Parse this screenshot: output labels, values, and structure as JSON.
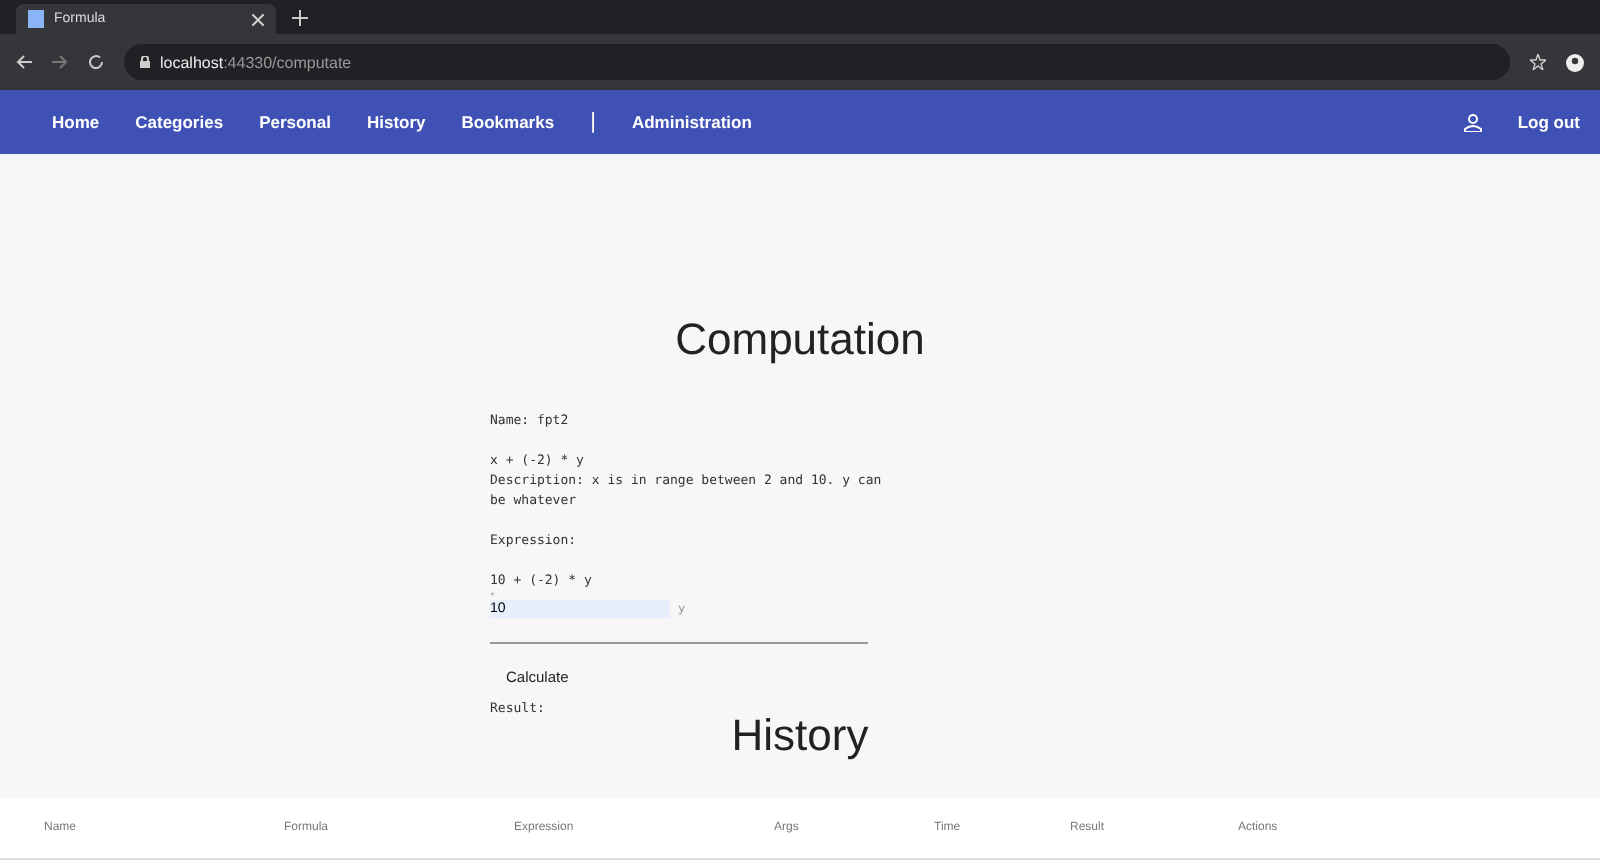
{
  "browser": {
    "tab_title": "Formula",
    "url_host": "localhost",
    "url_rest": ":44330/computate"
  },
  "nav": {
    "items": [
      {
        "label": "Home",
        "kind": "link"
      },
      {
        "label": "Categories",
        "kind": "link"
      },
      {
        "label": "Personal",
        "kind": "link"
      },
      {
        "label": "History",
        "kind": "link"
      },
      {
        "label": "Bookmarks",
        "kind": "link"
      },
      {
        "label": "|",
        "kind": "separator"
      },
      {
        "label": "Administration",
        "kind": "link"
      }
    ],
    "logout": "Log out"
  },
  "computation": {
    "title": "Computation",
    "name": "Name: fpt2",
    "formula": "x + (-2) * y",
    "description": "Description: x is in range between 2 and 10. y can be whatever",
    "expression_label": "Expression:",
    "expression": "10 + (-2) * y",
    "marker": "*",
    "args": [
      {
        "value": "10",
        "name": "y"
      }
    ],
    "calculate": "Calculate",
    "result_label": "Result:"
  },
  "history": {
    "title": "History",
    "columns": [
      "Name",
      "Formula",
      "Expression",
      "Args",
      "Time",
      "Result",
      "Actions"
    ]
  }
}
